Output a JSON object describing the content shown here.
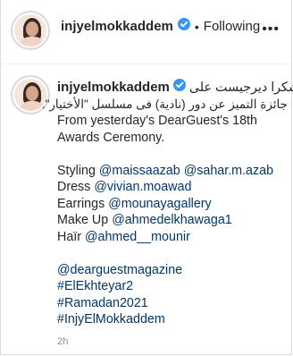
{
  "header": {
    "username": "injyelmokkaddem",
    "dot": "•",
    "following": "Following",
    "more": "•••"
  },
  "caption": {
    "username": "injyelmokkaddem",
    "arabic_line1": "شكرا ديرجيست على",
    "arabic_line2": "جائزة التميز عن دور (نادية) فى مسلسل \"الأختيار\".",
    "english_line1": "From yesterday's DearGuest's 18th",
    "english_line2": "Awards Ceremony.",
    "credits": [
      {
        "label": "Styling",
        "handles": [
          "@maissaazab",
          "@sahar.m.azab"
        ]
      },
      {
        "label": "Dress",
        "handles": [
          "@vivian.moawad"
        ]
      },
      {
        "label": "Earrings",
        "handles": [
          "@mounayagallery"
        ]
      },
      {
        "label": "Make Up",
        "handles": [
          "@ahmedelkhawaga1"
        ]
      },
      {
        "label": "Haïr",
        "handles": [
          "@ahmed__mounir"
        ]
      }
    ],
    "tags": [
      "@dearguestmagazine",
      "#ElEkhteyar2",
      "#Ramadan2021",
      "#InjyElMokkaddem"
    ]
  },
  "timestamp": "2h",
  "colors": {
    "link": "#00376b",
    "verified": "#3897f0",
    "muted": "#8e8e8e"
  }
}
